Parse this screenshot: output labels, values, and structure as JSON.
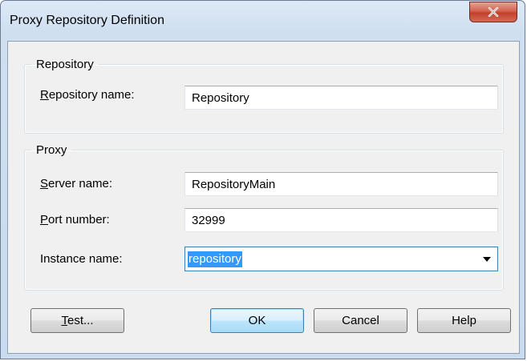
{
  "window": {
    "title": "Proxy Repository Definition",
    "close_label": "X"
  },
  "repository_group": {
    "legend": "Repository",
    "name_label_mnemonic": "R",
    "name_label_rest": "epository name:",
    "name_value": "Repository"
  },
  "proxy_group": {
    "legend": "Proxy",
    "server_label_mnemonic": "S",
    "server_label_rest": "erver name:",
    "server_value": "RepositoryMain",
    "port_label_mnemonic": "P",
    "port_label_rest": "ort number:",
    "port_value": "32999",
    "instance_label": "Instance name:",
    "instance_value": "repository"
  },
  "buttons": {
    "test_mnemonic": "T",
    "test_rest": "est...",
    "ok": "OK",
    "cancel": "Cancel",
    "help": "Help"
  },
  "colors": {
    "selection": "#3399ff",
    "close_button": "#c9402b",
    "default_button_border": "#3c7fb1"
  }
}
